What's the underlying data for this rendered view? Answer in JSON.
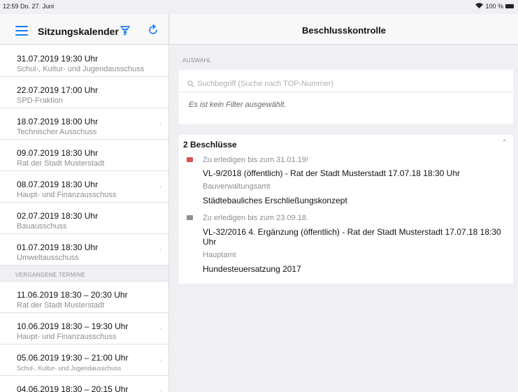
{
  "status": {
    "time": "12:59",
    "date": "Do. 27. Juni",
    "battery": "100 %"
  },
  "sidebar": {
    "title": "Sitzungskalender",
    "items": [
      {
        "datetime": "31.07.2019 19:30 Uhr",
        "committee": "Schul-, Kultur- und Jugendausschuss"
      },
      {
        "datetime": "22.07.2019 17:00 Uhr",
        "committee": "SPD-Fraktion"
      },
      {
        "datetime": "18.07.2019 18:00 Uhr",
        "committee": "Technischer Ausschuss"
      },
      {
        "datetime": "09.07.2019 18:30 Uhr",
        "committee": "Rat der Stadt Musterstadt"
      },
      {
        "datetime": "08.07.2019 18:30 Uhr",
        "committee": "Haupt- und Finanzausschuss"
      },
      {
        "datetime": "02.07.2019 18:30 Uhr",
        "committee": "Bauausschuss"
      },
      {
        "datetime": "01.07.2019 18:30 Uhr",
        "committee": "Umweltausschuss"
      }
    ],
    "past_label": "VERGANGENE TERMINE",
    "past_items": [
      {
        "datetime": "11.06.2019 18:30 – 20:30 Uhr",
        "committee": "Rat der Stadt Musterstadt"
      },
      {
        "datetime": "10.06.2019 18:30 – 19:30 Uhr",
        "committee": "Haupt- und Finanzausschuss"
      },
      {
        "datetime": "05.06.2019 19:30 – 21:00 Uhr",
        "committee": "Schul-, Kultur- und Jugendausschuss"
      },
      {
        "datetime": "04.06.2019 18:30 – 20:15 Uhr",
        "committee": ""
      }
    ]
  },
  "main": {
    "title": "Beschlusskontrolle",
    "section_label": "AUSWAHL",
    "search_placeholder": "Suchbegriff (Suche nach TOP-Nummer)",
    "filter_text": "Es ist kein Filter ausgewählt.",
    "results_heading": "2 Beschlüsse",
    "entries": [
      {
        "due": "Zu erledigen bis zum 31.01.19!",
        "title": "VL-9/2018 (öffentlich) - Rat der Stadt Musterstadt 17.07.18 18:30 Uhr",
        "department": "Bauverwaltungsamt",
        "subject": "Städtebauliches Erschließungskonzept",
        "flag_color": "#d9534f"
      },
      {
        "due": "Zu erledigen bis zum 23.09.18.",
        "title": "VL-32/2016 4. Ergänzung (öffentlich) - Rat der Stadt Musterstadt 17.07.18 18:30 Uhr",
        "department": "Hauptamt",
        "subject": "Hundesteuersatzung 2017",
        "flag_color": "#8e8e93"
      }
    ]
  },
  "colors": {
    "accent": "#1a7cf5"
  }
}
